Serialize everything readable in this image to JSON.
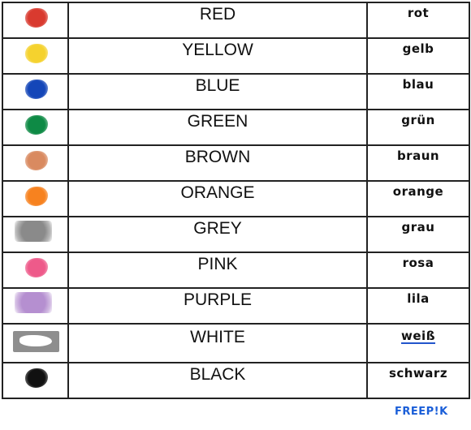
{
  "rows": [
    {
      "en": "RED",
      "de": "rot",
      "color": "#d93a2f"
    },
    {
      "en": "YELLOW",
      "de": "gelb",
      "color": "#f5d22e"
    },
    {
      "en": "BLUE",
      "de": "blau",
      "color": "#1446b8"
    },
    {
      "en": "GREEN",
      "de": "grün",
      "color": "#0e8a45"
    },
    {
      "en": "BROWN",
      "de": "braun",
      "color": "#d98a60"
    },
    {
      "en": "ORANGE",
      "de": "orange",
      "color": "#f7821f"
    },
    {
      "en": "GREY",
      "de": "grau",
      "color": "#8a8a8a"
    },
    {
      "en": "PINK",
      "de": "rosa",
      "color": "#ee5a8a"
    },
    {
      "en": "PURPLE",
      "de": "lila",
      "color": "#b58fd0"
    },
    {
      "en": "WHITE",
      "de": "weiß",
      "color": "#ffffff"
    },
    {
      "en": "BLACK",
      "de": "schwarz",
      "color": "#111111"
    }
  ],
  "brand": "FREEP!K"
}
